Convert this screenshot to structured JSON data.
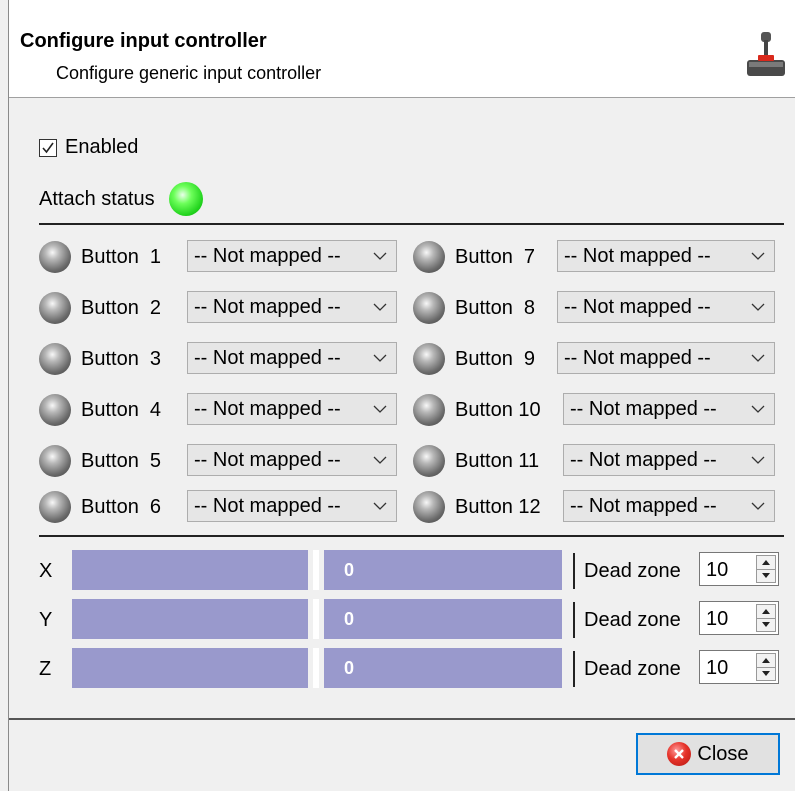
{
  "header": {
    "title": "Configure input controller",
    "subtitle": "Configure generic input controller",
    "icon": "joystick-icon"
  },
  "enabled": {
    "label": "Enabled",
    "checked": true
  },
  "attach": {
    "label": "Attach status",
    "status_color": "#33dd22"
  },
  "buttons": [
    {
      "label": "Button  1",
      "mapping": "-- Not mapped --"
    },
    {
      "label": "Button  2",
      "mapping": "-- Not mapped --"
    },
    {
      "label": "Button  3",
      "mapping": "-- Not mapped --"
    },
    {
      "label": "Button  4",
      "mapping": "-- Not mapped --"
    },
    {
      "label": "Button  5",
      "mapping": "-- Not mapped --"
    },
    {
      "label": "Button  6",
      "mapping": "-- Not mapped --"
    },
    {
      "label": "Button  7",
      "mapping": "-- Not mapped --"
    },
    {
      "label": "Button  8",
      "mapping": "-- Not mapped --"
    },
    {
      "label": "Button  9",
      "mapping": "-- Not mapped --"
    },
    {
      "label": "Button 10",
      "mapping": "-- Not mapped --"
    },
    {
      "label": "Button 11",
      "mapping": "-- Not mapped --"
    },
    {
      "label": "Button 12",
      "mapping": "-- Not mapped --"
    }
  ],
  "axes": [
    {
      "label": "X",
      "value": "0",
      "dead_zone_label": "Dead zone",
      "dead_zone": "10"
    },
    {
      "label": "Y",
      "value": "0",
      "dead_zone_label": "Dead zone",
      "dead_zone": "10"
    },
    {
      "label": "Z",
      "value": "0",
      "dead_zone_label": "Dead zone",
      "dead_zone": "10"
    }
  ],
  "close_button": {
    "label": "Close",
    "icon": "close-circle-icon"
  },
  "colors": {
    "axis_bar": "#9999cc",
    "accent": "#0078d7"
  }
}
